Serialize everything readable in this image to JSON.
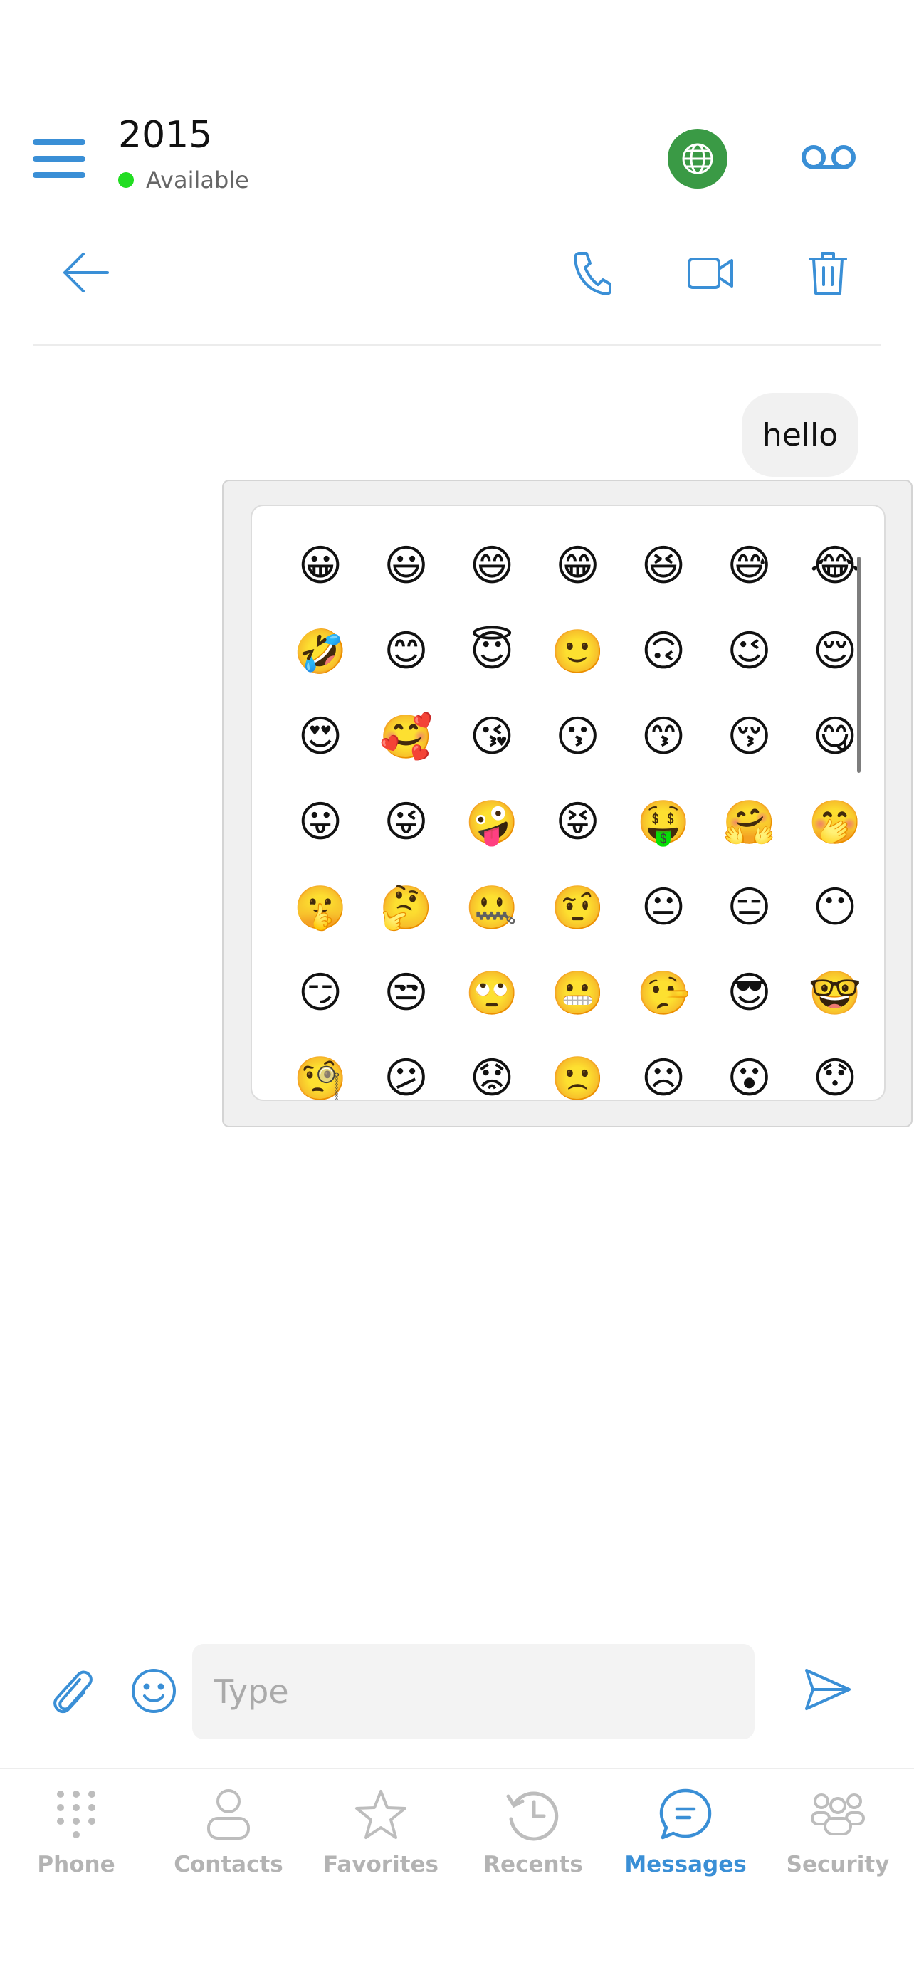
{
  "header": {
    "title": "2015",
    "status_text": "Available",
    "status_color": "#22dd22",
    "accent_color": "#3a8fd6",
    "globe_color": "#3a9a45"
  },
  "toolbar": {
    "icons": [
      "back-arrow-icon",
      "phone-icon",
      "video-icon",
      "trash-icon"
    ]
  },
  "messages": [
    {
      "text": "hello",
      "direction": "outgoing"
    }
  ],
  "emoji_picker": {
    "emojis": [
      "😀",
      "😃",
      "😄",
      "😁",
      "😆",
      "😅",
      "😂",
      "🤣",
      "😊",
      "😇",
      "🙂",
      "🙃",
      "😉",
      "😌",
      "😍",
      "🥰",
      "😘",
      "😗",
      "😙",
      "😚",
      "😋",
      "😛",
      "😜",
      "🤪",
      "😝",
      "🤑",
      "🤗",
      "🤭",
      "🤫",
      "🤔",
      "🤐",
      "🤨",
      "😐",
      "😑",
      "😶",
      "😏",
      "😒",
      "🙄",
      "😬",
      "🤥",
      "😎",
      "🤓",
      "🧐",
      "😕",
      "😟",
      "🙁",
      "☹",
      "😮",
      "😯"
    ]
  },
  "composer": {
    "placeholder": "Type",
    "value": ""
  },
  "nav": {
    "items": [
      {
        "label": "Phone",
        "icon": "dialpad-icon",
        "active": false
      },
      {
        "label": "Contacts",
        "icon": "person-icon",
        "active": false
      },
      {
        "label": "Favorites",
        "icon": "star-icon",
        "active": false
      },
      {
        "label": "Recents",
        "icon": "history-icon",
        "active": false
      },
      {
        "label": "Messages",
        "icon": "chat-icon",
        "active": true
      },
      {
        "label": "Security",
        "icon": "group-icon",
        "active": false
      }
    ],
    "active_color": "#3a8fd6",
    "inactive_color": "#b3b3b3"
  }
}
